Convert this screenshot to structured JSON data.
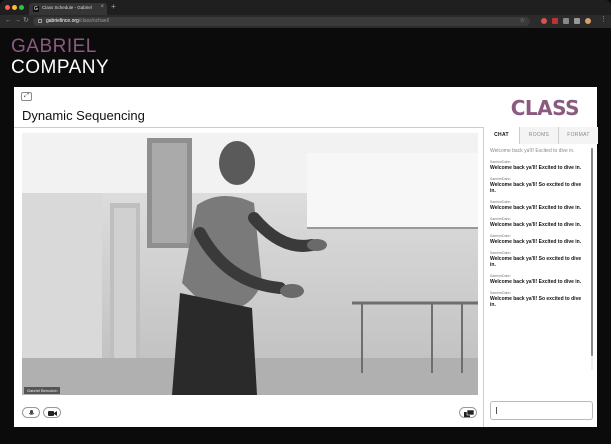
{
  "browser": {
    "tab_title": "Class Schedule - Gabriel",
    "tab_favicon": "G",
    "url_host": "gabrielince.org",
    "url_path": "/class/ochael/"
  },
  "header": {
    "brand_line1": "GABRIEL",
    "brand_line2": "COMPANY",
    "brand_accent_color": "#8b5a80"
  },
  "class": {
    "title": "Dynamic Sequencing",
    "logo_text": "CLASS",
    "video_label": "Gabriel Benoxich"
  },
  "chat": {
    "tabs": [
      {
        "label": "CHAT",
        "active": true
      },
      {
        "label": "ROOMS",
        "active": false
      },
      {
        "label": "FORMAT",
        "active": false
      }
    ],
    "messages": [
      {
        "who": "",
        "text": "Welcome back ya'll! Excited to dive in.",
        "faded": true
      },
      {
        "who": "SamIneDahn",
        "text": "Welcome back ya'll! Excited to dive in.",
        "faded": false
      },
      {
        "who": "SamIneDahn",
        "text": "Welcome back ya'll! So excited to dive in.",
        "faded": false
      },
      {
        "who": "SamIneDahn",
        "text": "Welcome back ya'll! Excited to dive in.",
        "faded": false
      },
      {
        "who": "SamIneDahn",
        "text": "Welcome back ya'll! Excited to dive in.",
        "faded": false
      },
      {
        "who": "SamIneDahn",
        "text": "Welcome back ya'll! Excited to dive in.",
        "faded": false
      },
      {
        "who": "SamIneDahn",
        "text": "Welcome back ya'll! So excited to dive in.",
        "faded": false
      },
      {
        "who": "SamIneDahn",
        "text": "Welcome back ya'll! Excited to dive in.",
        "faded": false
      },
      {
        "who": "SamIneDahn",
        "text": "Welcome back ya'll! So excited to dive in.",
        "faded": false
      }
    ]
  },
  "icons": {
    "expand": "expand-icon",
    "mic": "microphone-icon",
    "camera": "video-camera-icon",
    "screens": "screen-switch-icon"
  }
}
